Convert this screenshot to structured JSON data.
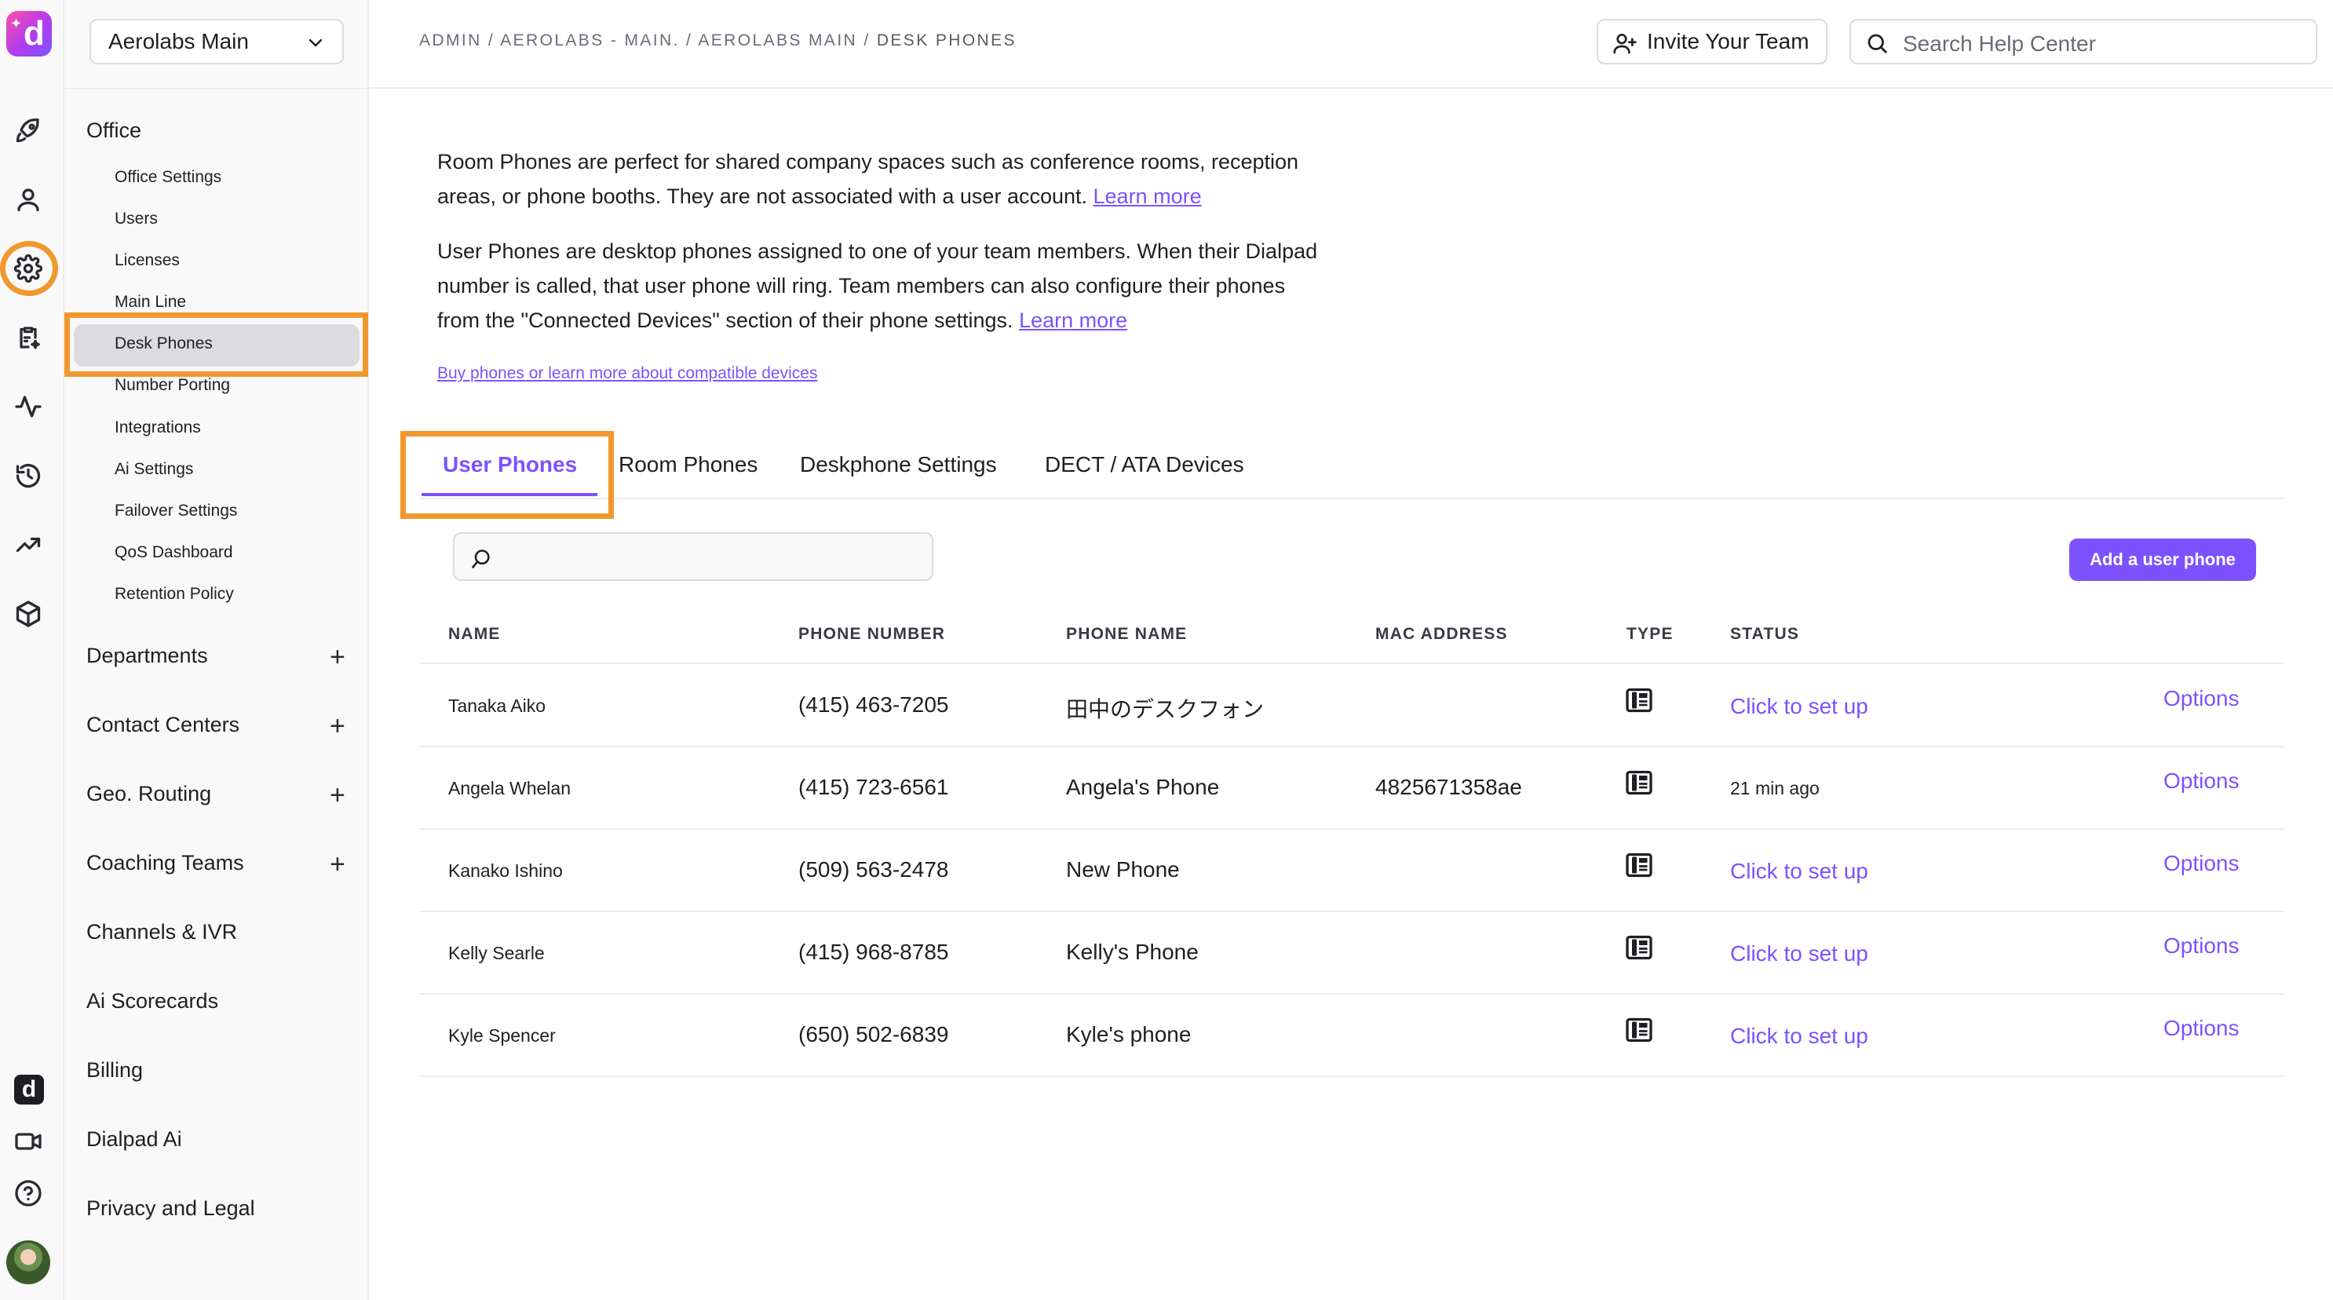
{
  "workspace": {
    "name": "Aerolabs Main"
  },
  "rail": {
    "icons": [
      "rocket-icon",
      "person-icon",
      "gear-icon",
      "clipboard-sparkle-icon",
      "activity-icon",
      "history-icon",
      "trending-icon",
      "cube-icon",
      "dialpad-app-icon",
      "video-icon",
      "help-icon",
      "avatar"
    ]
  },
  "sidebar": {
    "office_heading": "Office",
    "office_items": [
      "Office Settings",
      "Users",
      "Licenses",
      "Main Line",
      "Desk Phones",
      "Number Porting",
      "Integrations",
      "Ai Settings",
      "Failover Settings",
      "QoS Dashboard",
      "Retention Policy"
    ],
    "sections": [
      {
        "label": "Departments",
        "expandable": true
      },
      {
        "label": "Contact Centers",
        "expandable": true
      },
      {
        "label": "Geo. Routing",
        "expandable": true
      },
      {
        "label": "Coaching Teams",
        "expandable": true
      },
      {
        "label": "Channels & IVR",
        "expandable": false
      },
      {
        "label": "Ai Scorecards",
        "expandable": false
      },
      {
        "label": "Billing",
        "expandable": false
      },
      {
        "label": "Dialpad Ai",
        "expandable": false
      },
      {
        "label": "Privacy and Legal",
        "expandable": false
      }
    ]
  },
  "header": {
    "breadcrumb_prefix": "ADMIN / AEROLABS - MAIN. / AEROLABS MAIN / ",
    "breadcrumb_current": "DESK PHONES",
    "invite_label": "Invite Your Team",
    "search_placeholder": "Search Help Center"
  },
  "intro": {
    "room_text": "Room Phones are perfect for shared company spaces such as conference rooms, reception areas, or phone booths. They are not associated with a user account. ",
    "room_link": "Learn more",
    "user_text": "User Phones are desktop phones assigned to one of your team members. When their Dialpad number is called, that user phone will ring. Team members can also configure their phones from the \"Connected Devices\" section of their phone settings. ",
    "user_link": "Learn more",
    "buy_link": "Buy phones or learn more about compatible devices"
  },
  "tabs": [
    "User Phones",
    "Room Phones",
    "Deskphone Settings",
    "DECT / ATA Devices"
  ],
  "table": {
    "search_value": "",
    "add_button": "Add a user phone",
    "columns": [
      "NAME",
      "PHONE NUMBER",
      "PHONE NAME",
      "MAC ADDRESS",
      "TYPE",
      "STATUS"
    ],
    "rows": [
      {
        "name": "Tanaka Aiko",
        "phone": "(415) 463-7205",
        "phone_name": "田中のデスクフォン",
        "mac": "",
        "type": "deskphone-icon",
        "status": "Click to set up",
        "status_is_link": true,
        "options": "Options"
      },
      {
        "name": "Angela Whelan",
        "phone": "(415) 723-6561",
        "phone_name": "Angela's Phone",
        "mac": "4825671358ae",
        "type": "deskphone-icon",
        "status": "21 min ago",
        "status_is_link": false,
        "options": "Options"
      },
      {
        "name": "Kanako Ishino",
        "phone": "(509) 563-2478",
        "phone_name": "New Phone",
        "mac": "",
        "type": "deskphone-icon",
        "status": "Click to set up",
        "status_is_link": true,
        "options": "Options"
      },
      {
        "name": "Kelly Searle",
        "phone": "(415) 968-8785",
        "phone_name": "Kelly's Phone",
        "mac": "",
        "type": "deskphone-icon",
        "status": "Click to set up",
        "status_is_link": true,
        "options": "Options"
      },
      {
        "name": "Kyle Spencer",
        "phone": "(650) 502-6839",
        "phone_name": "Kyle's phone",
        "mac": "",
        "type": "deskphone-icon",
        "status": "Click to set up",
        "status_is_link": true,
        "options": "Options"
      }
    ]
  },
  "colors": {
    "accent": "#7c52ff",
    "highlight": "#f0982e"
  }
}
